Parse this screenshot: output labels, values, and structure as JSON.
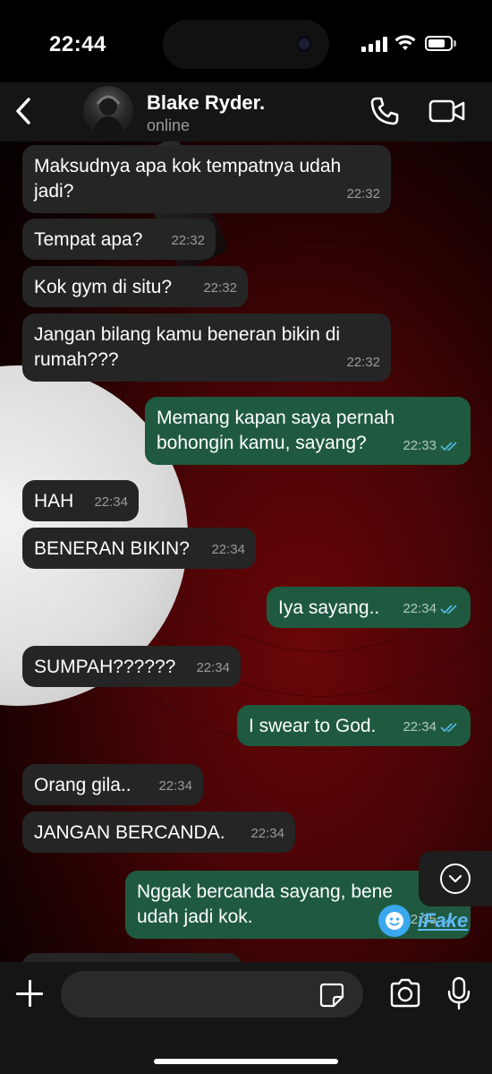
{
  "status_bar": {
    "time": "22:44"
  },
  "header": {
    "contact_name": "Blake Ryder.",
    "contact_status": "online"
  },
  "messages": [
    {
      "dir": "in",
      "text": "Maksudnya apa kok tempatnya udah jadi?",
      "time": "22:32"
    },
    {
      "dir": "in",
      "text": "Tempat apa?",
      "time": "22:32"
    },
    {
      "dir": "in",
      "text": "Kok gym di situ?",
      "time": "22:32"
    },
    {
      "dir": "in",
      "text": "Jangan bilang kamu beneran bikin di rumah???",
      "time": "22:32"
    },
    {
      "dir": "out",
      "text": "Memang kapan saya pernah bohongin kamu, sayang?",
      "time": "22:33",
      "read": true
    },
    {
      "dir": "in",
      "text": "HAH",
      "time": "22:34"
    },
    {
      "dir": "in",
      "text": "BENERAN BIKIN?",
      "time": "22:34"
    },
    {
      "dir": "out",
      "text": "Iya sayang..",
      "time": "22:34",
      "read": true
    },
    {
      "dir": "in",
      "text": "SUMPAH??????",
      "time": "22:34"
    },
    {
      "dir": "out",
      "text": "I swear to God.",
      "time": "22:34",
      "read": true
    },
    {
      "dir": "in",
      "text": "Orang gila..",
      "time": "22:34"
    },
    {
      "dir": "in",
      "text": "JANGAN BERCANDA.",
      "time": "22:34"
    },
    {
      "dir": "out",
      "text": "Nggak bercanda sayang, bene udah jadi kok.",
      "time": "22:35",
      "read": true
    }
  ],
  "watermark": {
    "text": "iFake"
  },
  "colors": {
    "incoming_bubble": "#252525",
    "outgoing_bubble": "#1f5a40",
    "read_tick": "#53bdeb"
  }
}
